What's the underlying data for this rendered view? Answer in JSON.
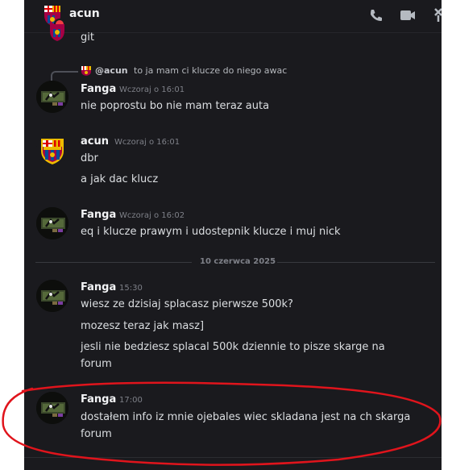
{
  "header": {
    "title": "acun",
    "icons": [
      "phone-icon",
      "video-icon",
      "pin-icon"
    ]
  },
  "messages": {
    "partial": {
      "text": "git"
    },
    "m1": {
      "reply": {
        "name": "@acun",
        "text": "to ja mam ci klucze do niego awac"
      },
      "author": "Fanga",
      "time": "Wczoraj o 16:01",
      "lines": [
        "nie poprostu bo nie mam teraz auta"
      ]
    },
    "m2": {
      "author": "acun",
      "time": "Wczoraj o 16:01",
      "lines": [
        "dbr",
        "a jak dac klucz"
      ]
    },
    "m3": {
      "author": "Fanga",
      "time": "Wczoraj o 16:02",
      "lines": [
        "eq i klucze prawym i udostepnik klucze i muj nick"
      ]
    },
    "date_divider": "10 czerwca 2025",
    "m4": {
      "author": "Fanga",
      "time": "15:30",
      "lines": [
        "wiesz ze dzisiaj splacasz pierwsze 500k?",
        "mozesz teraz jak masz]",
        "jesli nie bedziesz splacal 500k dziennie to pisze skarge na",
        "forum"
      ]
    },
    "m5": {
      "author": "Fanga",
      "time": "17:00",
      "lines": [
        "dostałem info iz mnie ojebales wiec skladana jest na ch skarga",
        "forum"
      ]
    }
  },
  "colors": {
    "background": "#1a1a1e",
    "text": "#dbdee1",
    "username": "#f2f3f5",
    "timestamp": "#7e8088",
    "annotation": "#e0141c"
  }
}
